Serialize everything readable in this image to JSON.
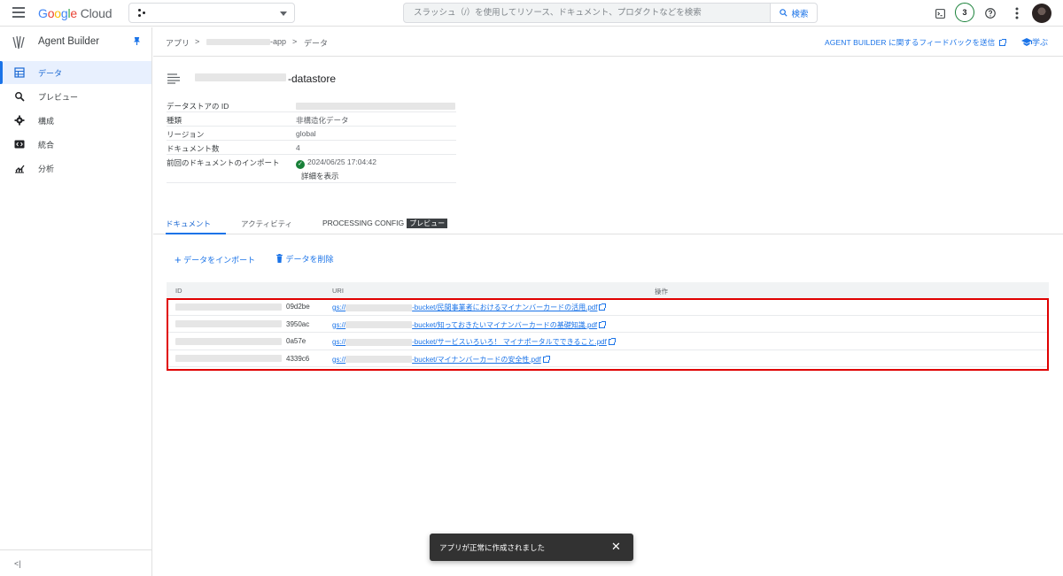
{
  "topbar": {
    "logo_letters": [
      "G",
      "o",
      "o",
      "g",
      "l",
      "e"
    ],
    "logo_cloud": "Cloud",
    "search_placeholder": "スラッシュ（/）を使用してリソース、ドキュメント、プロダクトなどを検索",
    "search_button": "検索",
    "notification_count": "3"
  },
  "sidebar": {
    "title": "Agent Builder",
    "items": [
      {
        "label": "データ",
        "icon": "table-icon",
        "active": true
      },
      {
        "label": "プレビュー",
        "icon": "search-icon"
      },
      {
        "label": "構成",
        "icon": "gear-icon"
      },
      {
        "label": "統合",
        "icon": "code-icon"
      },
      {
        "label": "分析",
        "icon": "analytics-icon"
      }
    ],
    "collapse": "<|"
  },
  "breadcrumb": {
    "app": "アプリ",
    "app_name_suffix": "-app",
    "current": "データ",
    "sep": ">"
  },
  "header_links": {
    "feedback": "AGENT BUILDER に関するフィードバックを送信",
    "learn": "学ぶ"
  },
  "datastore": {
    "title_suffix": "-datastore",
    "properties": [
      {
        "key": "データストアの ID",
        "value": ""
      },
      {
        "key": "種類",
        "value": "非構造化データ"
      },
      {
        "key": "リージョン",
        "value": "global"
      },
      {
        "key": "ドキュメント数",
        "value": "4"
      }
    ],
    "last_import_key": "前回のドキュメントのインポート",
    "last_import_value": "2024/06/25 17:04:42",
    "details_link": "詳細を表示"
  },
  "tabs": [
    {
      "label": "ドキュメント",
      "active": true
    },
    {
      "label": "アクティビティ"
    },
    {
      "label": "PROCESSING CONFIG",
      "tag": "プレビュー"
    }
  ],
  "actions": {
    "import": "データをインポート",
    "delete": "データを削除"
  },
  "table": {
    "headers": [
      "ID",
      "URI",
      "操作"
    ],
    "rows": [
      {
        "id_suffix": "09d2be",
        "uri_prefix": "gs://",
        "uri_suffix": "-bucket/民間事業者におけるマイナンバーカードの活用.pdf"
      },
      {
        "id_suffix": "3950ac",
        "uri_prefix": "gs://",
        "uri_suffix": "-bucket/知っておきたいマイナンバーカードの基礎知識.pdf"
      },
      {
        "id_suffix": "0a57e",
        "uri_prefix": "gs://",
        "uri_suffix": "-bucket/サービスいろいろ！ マイナポータルでできること.pdf"
      },
      {
        "id_suffix": "4339c6",
        "uri_prefix": "gs://",
        "uri_suffix": "-bucket/マイナンバーカードの安全性.pdf"
      }
    ]
  },
  "snackbar": {
    "message": "アプリが正常に作成されました",
    "close": "✕"
  },
  "colors": {
    "accent": "#1a73e8",
    "highlight_border": "#e00000",
    "success": "#188038"
  }
}
